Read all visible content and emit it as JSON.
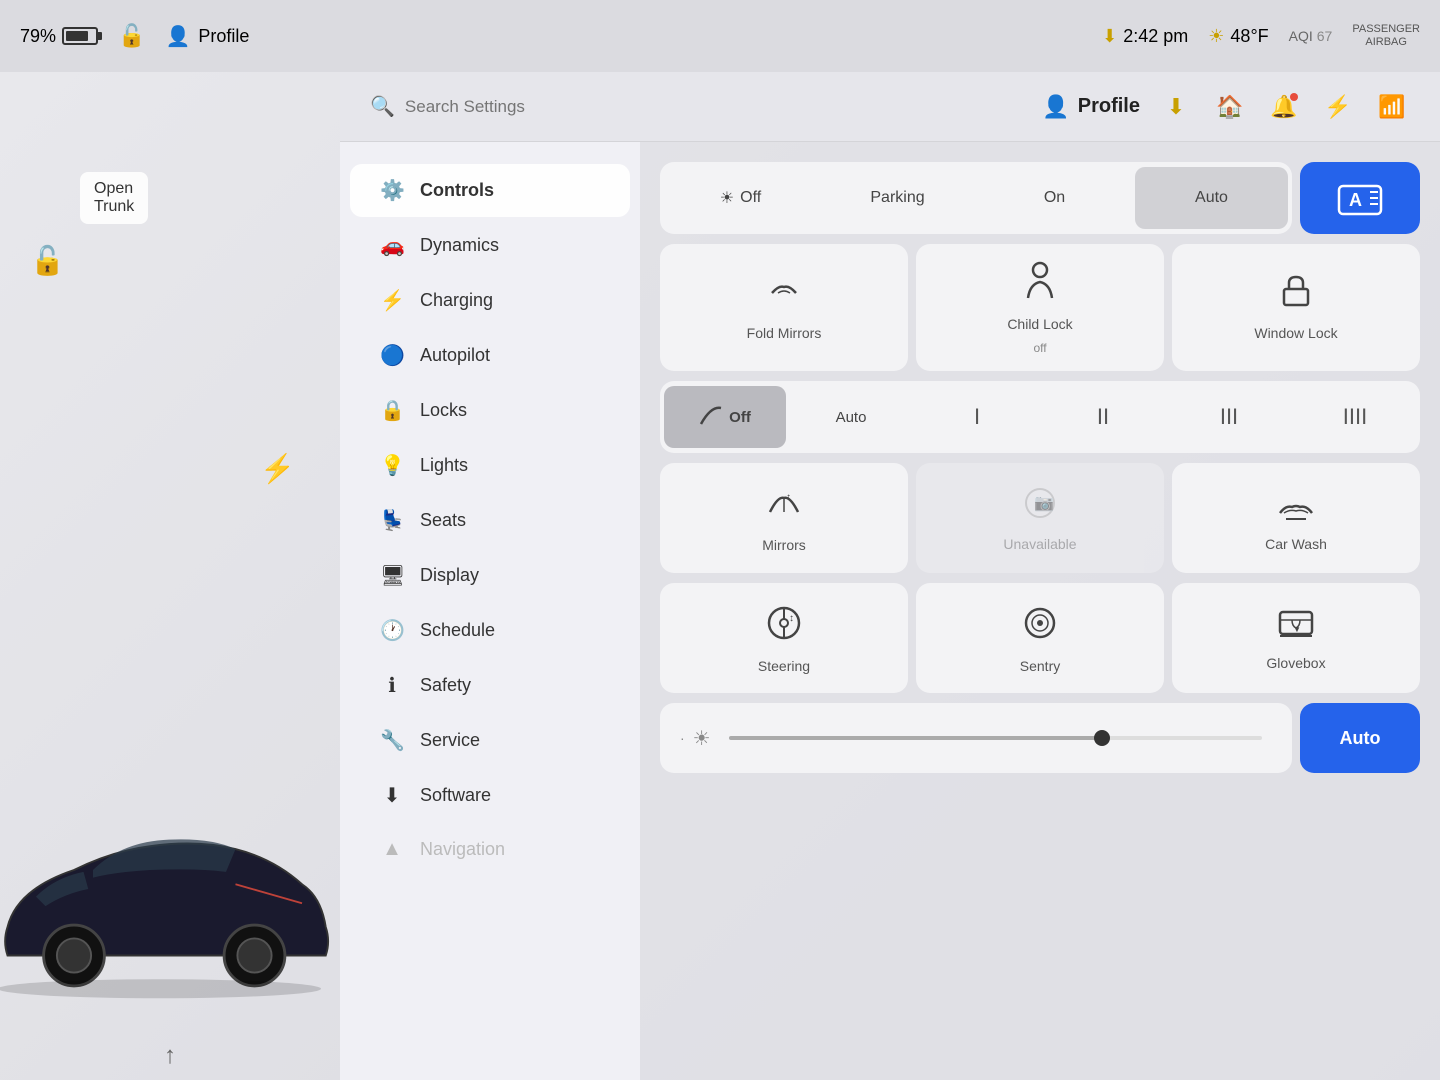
{
  "statusBar": {
    "battery_percent": "79%",
    "lock_icon": "🔒",
    "profile_label": "Profile",
    "time": "2:42 pm",
    "sun_icon": "☀",
    "temperature": "48°F",
    "aqi_label": "AQI",
    "aqi_value": "67",
    "passenger_airbag_line1": "PASSENGER",
    "passenger_airbag_line2": "AIRBAG"
  },
  "header": {
    "search_placeholder": "Search Settings",
    "profile_label": "Profile",
    "download_icon": "⬇",
    "home_icon": "🏠",
    "bell_icon": "🔔",
    "bluetooth_icon": "⚡",
    "signal_icon": "📶"
  },
  "sidebar": {
    "items": [
      {
        "id": "controls",
        "label": "Controls",
        "icon": "⚙",
        "active": true
      },
      {
        "id": "dynamics",
        "label": "Dynamics",
        "icon": "🚗"
      },
      {
        "id": "charging",
        "label": "Charging",
        "icon": "⚡"
      },
      {
        "id": "autopilot",
        "label": "Autopilot",
        "icon": "🔵"
      },
      {
        "id": "locks",
        "label": "Locks",
        "icon": "🔒"
      },
      {
        "id": "lights",
        "label": "Lights",
        "icon": "💡"
      },
      {
        "id": "seats",
        "label": "Seats",
        "icon": "💺"
      },
      {
        "id": "display",
        "label": "Display",
        "icon": "🖥"
      },
      {
        "id": "schedule",
        "label": "Schedule",
        "icon": "🕐"
      },
      {
        "id": "safety",
        "label": "Safety",
        "icon": "ℹ"
      },
      {
        "id": "service",
        "label": "Service",
        "icon": "🔧"
      },
      {
        "id": "software",
        "label": "Software",
        "icon": "⬇"
      },
      {
        "id": "navigation",
        "label": "Navigation",
        "icon": "▲"
      }
    ]
  },
  "controls": {
    "lighting": {
      "off_label": "Off",
      "parking_label": "Parking",
      "on_label": "On",
      "auto_label": "Auto",
      "active": "Auto"
    },
    "fold_mirrors": {
      "label": "Fold Mirrors"
    },
    "child_lock": {
      "label": "Child Lock",
      "sublabel": "off"
    },
    "window_lock": {
      "label": "Window Lock"
    },
    "wipers": {
      "off_label": "Off",
      "auto_label": "Auto",
      "speed1": "I",
      "speed2": "II",
      "speed3": "III",
      "speed4": "IIII",
      "active": "Off"
    },
    "mirrors_label": "Mirrors",
    "unavailable_label": "Unavailable",
    "car_wash_label": "Car Wash",
    "steering_label": "Steering",
    "sentry_label": "Sentry",
    "glovebox_label": "Glovebox",
    "brightness": {
      "auto_label": "Auto"
    }
  },
  "car": {
    "open_trunk_label": "Open\nTrunk",
    "open_trunk_line1": "Open",
    "open_trunk_line2": "Trunk"
  }
}
